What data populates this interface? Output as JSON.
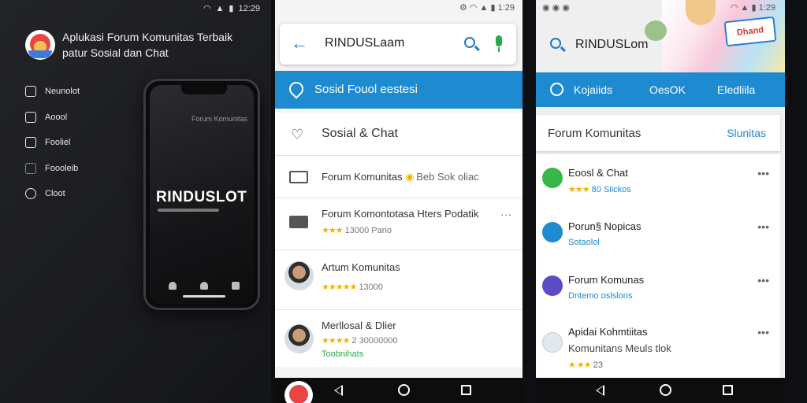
{
  "panel1": {
    "status_time": "12:29",
    "title_line1": "Aplukasi Forum Komunitas Terbaik",
    "title_line2": "patur Sosial dan Chat",
    "menu": [
      {
        "label": "Neunolot",
        "icon": "shield-icon"
      },
      {
        "label": "Aoool",
        "icon": "home-icon"
      },
      {
        "label": "Fooliel",
        "icon": "info-icon"
      },
      {
        "label": "Foooleib",
        "icon": "grid-icon"
      },
      {
        "label": "Cloot",
        "icon": "clock-icon"
      }
    ],
    "phone": {
      "subtitle": "Forum Komunitas",
      "brand": "RINDUSLOT"
    }
  },
  "panel2": {
    "status_time": "1:29",
    "search_query": "RINDUSLaam",
    "blue_bar_label": "Sosid Fouol eestesi",
    "rows": [
      {
        "title": "Sosial & Chat",
        "icon": "heart-icon"
      },
      {
        "title": "Forum Komunitas",
        "extra": "Beb Sok oliac",
        "icon": "folder-icon"
      },
      {
        "title": "Forum Komontotasa Hters Podatik",
        "rating": "13000 Pario",
        "icon": "folder-filled-icon"
      },
      {
        "title": "Artum Komunitas",
        "rating": "13000",
        "icon": "avatar-icon"
      },
      {
        "title": "Merllosal & Dlier",
        "rating": "2 30000000",
        "sub2": "Toobnihats",
        "icon": "avatar-icon"
      }
    ],
    "more_label": "···"
  },
  "panel3": {
    "status_time": "1:29",
    "search_query": "RINDUSLom",
    "badge": "Dhand",
    "tabs": [
      "Kojaiids",
      "OesOK",
      "Eledliila"
    ],
    "section_title": "Forum Komunitas",
    "section_action": "Slunitas",
    "rows": [
      {
        "title": "Eoosl & Chat",
        "sub": "80 Siickos",
        "color": "#39b54a",
        "icon": "chat-icon"
      },
      {
        "title": "Porun§ Nopicas",
        "sub": "Sotaolol",
        "color": "#1e8ad0",
        "icon": "check-icon"
      },
      {
        "title": "Forum Komunas",
        "sub": "Dntemo oslslons",
        "color": "#5b4bc4",
        "icon": "clock-icon"
      },
      {
        "title": "Apidai Kohmtiitas",
        "title2": "Komunitans Meuls tlok",
        "sub": "23",
        "color": "#e2e8f0",
        "icon": "avatar-icon"
      }
    ],
    "more_label": "•••"
  },
  "colors": {
    "accent": "#1e8ad0",
    "star": "#f0b400",
    "dark": "#1b1c20"
  }
}
